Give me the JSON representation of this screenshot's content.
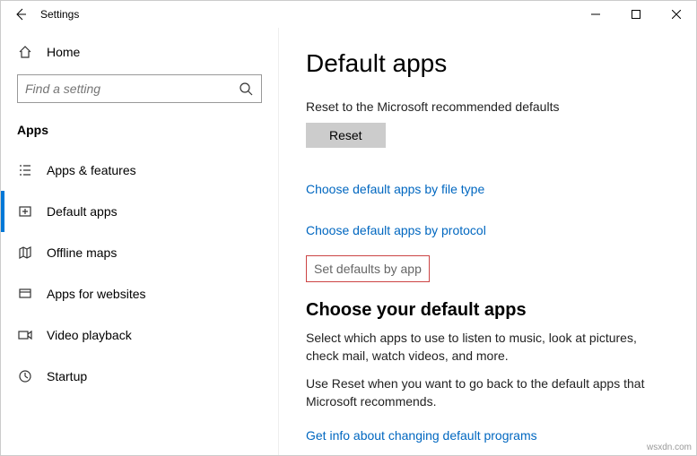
{
  "window": {
    "title": "Settings"
  },
  "sidebar": {
    "home_label": "Home",
    "search_placeholder": "Find a setting",
    "section_label": "Apps",
    "items": [
      {
        "label": "Apps & features"
      },
      {
        "label": "Default apps"
      },
      {
        "label": "Offline maps"
      },
      {
        "label": "Apps for websites"
      },
      {
        "label": "Video playback"
      },
      {
        "label": "Startup"
      }
    ]
  },
  "content": {
    "page_title": "Default apps",
    "reset_text": "Reset to the Microsoft recommended defaults",
    "reset_button": "Reset",
    "link_filetype": "Choose default apps by file type",
    "link_protocol": "Choose default apps by protocol",
    "link_byapp": "Set defaults by app",
    "subhead": "Choose your default apps",
    "desc1": "Select which apps to use to listen to music, look at pictures, check mail, watch videos, and more.",
    "desc2": "Use Reset when you want to go back to the default apps that Microsoft recommends.",
    "link_info": "Get info about changing default programs"
  },
  "watermark": "wsxdn.com"
}
